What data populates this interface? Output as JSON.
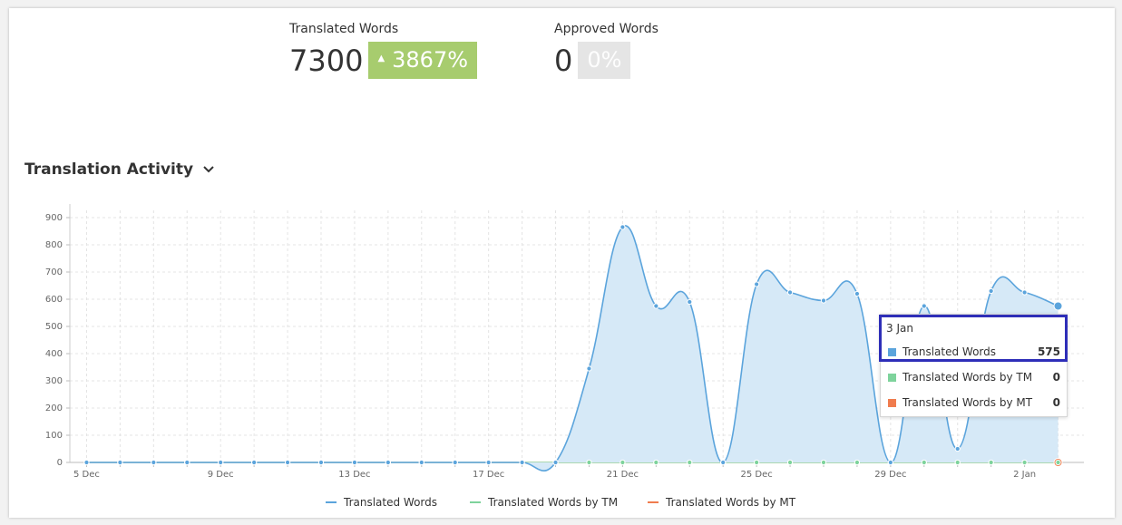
{
  "stats": {
    "translated": {
      "label": "Translated Words",
      "value": "7300",
      "change": "3867%"
    },
    "approved": {
      "label": "Approved Words",
      "value": "0",
      "change": "0%"
    }
  },
  "section": {
    "title": "Translation Activity"
  },
  "colors": {
    "translated": "#5ba4dc",
    "tm": "#7ed39c",
    "mt": "#f07c4e",
    "area": "#d6e9f7"
  },
  "chart_data": {
    "type": "area",
    "title": "Translation Activity",
    "x_ticks": [
      "5 Dec",
      "9 Dec",
      "13 Dec",
      "17 Dec",
      "21 Dec",
      "25 Dec",
      "29 Dec",
      "2 Jan"
    ],
    "y_ticks": [
      "0",
      "100",
      "200",
      "300",
      "400",
      "500",
      "600",
      "700",
      "800",
      "900"
    ],
    "ylim": [
      0,
      900
    ],
    "x": [
      "5 Dec",
      "6 Dec",
      "7 Dec",
      "8 Dec",
      "9 Dec",
      "10 Dec",
      "11 Dec",
      "12 Dec",
      "13 Dec",
      "14 Dec",
      "15 Dec",
      "16 Dec",
      "17 Dec",
      "18 Dec",
      "19 Dec",
      "20 Dec",
      "21 Dec",
      "22 Dec",
      "23 Dec",
      "24 Dec",
      "25 Dec",
      "26 Dec",
      "27 Dec",
      "28 Dec",
      "29 Dec",
      "30 Dec",
      "31 Dec",
      "1 Jan",
      "2 Jan",
      "3 Jan"
    ],
    "series": [
      {
        "name": "Translated Words",
        "values": [
          0,
          0,
          0,
          0,
          0,
          0,
          0,
          0,
          0,
          0,
          0,
          0,
          0,
          0,
          0,
          345,
          865,
          575,
          590,
          0,
          655,
          625,
          595,
          620,
          0,
          575,
          50,
          630,
          625,
          575
        ]
      },
      {
        "name": "Translated Words by TM",
        "values": [
          0,
          0,
          0,
          0,
          0,
          0,
          0,
          0,
          0,
          0,
          0,
          0,
          0,
          0,
          0,
          0,
          0,
          0,
          0,
          0,
          0,
          0,
          0,
          0,
          0,
          0,
          0,
          0,
          0,
          0
        ]
      },
      {
        "name": "Translated Words by MT",
        "values": [
          0,
          0,
          0,
          0,
          0,
          0,
          0,
          0,
          0,
          0,
          0,
          0,
          0,
          0,
          0,
          0,
          0,
          0,
          0,
          0,
          0,
          0,
          0,
          0,
          0,
          0,
          0,
          0,
          0,
          0
        ]
      }
    ],
    "grid": true,
    "legend": "bottom"
  },
  "tooltip": {
    "date": "3 Jan",
    "rows": [
      {
        "name": "Translated Words",
        "value": "575",
        "color": "#5ba4dc"
      },
      {
        "name": "Translated Words by TM",
        "value": "0",
        "color": "#7ed39c"
      },
      {
        "name": "Translated Words by MT",
        "value": "0",
        "color": "#f07c4e"
      }
    ]
  }
}
